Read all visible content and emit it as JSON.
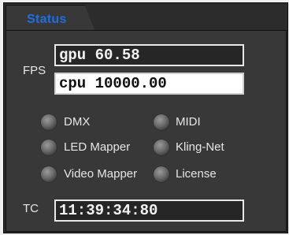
{
  "tab": {
    "title": "Status"
  },
  "fps": {
    "label": "FPS",
    "gpu": "gpu 60.58",
    "cpu": "cpu 10000.00"
  },
  "indicators": [
    {
      "label": "DMX"
    },
    {
      "label": "MIDI"
    },
    {
      "label": "LED Mapper"
    },
    {
      "label": "Kling-Net"
    },
    {
      "label": "Video Mapper"
    },
    {
      "label": "License"
    }
  ],
  "timecode": {
    "label": "TC",
    "value": "11:39:34:80"
  },
  "colors": {
    "tab_title": "#1e6ee6",
    "panel_bg": "#383838",
    "led_inactive": "#6a6a6a"
  }
}
